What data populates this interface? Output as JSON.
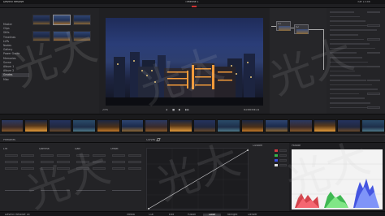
{
  "menubar": {
    "apple": "",
    "app_name": "DaVinci Resolve",
    "menus": [
      "File",
      "Edit",
      "Trim",
      "Timeline",
      "Clip",
      "Mark",
      "View",
      "Playback",
      "Fusion",
      "Color",
      "Fairlight",
      "Workspace",
      "Help"
    ],
    "project_title": "Timeline 1",
    "status_right": "Tue 13:46"
  },
  "media": {
    "clips": [
      {
        "label": "01"
      },
      {
        "label": "02"
      },
      {
        "label": "03"
      },
      {
        "label": "04"
      },
      {
        "label": "05"
      },
      {
        "label": "06"
      }
    ],
    "sidebar_items": [
      "Master",
      "Clips",
      "Stills",
      "Timelines",
      "LUTs",
      "Nodes",
      "Gallery",
      "Power Grade",
      "Memories",
      "Scene",
      "Album 1",
      "Album 2",
      "Grades",
      "Misc"
    ],
    "selected_sidebar_index": 12
  },
  "viewer": {
    "timecode_left": "00:00:00:00",
    "timecode_right": "01:00:04:21",
    "zoom": "25%"
  },
  "nodes": {
    "node1_label": "01",
    "node2_label": "02"
  },
  "timeline_strip": {
    "clip_count": 16
  },
  "color_panel": {
    "section1_title": "Primaries",
    "section2_title": "Curves",
    "section3_title": "Custom",
    "wheel_labels": [
      "Lift",
      "Gamma",
      "Gain",
      "Offset"
    ],
    "curves_label": "Custom",
    "scope_title": "Parade"
  },
  "watermark": {
    "text": "光大"
  },
  "status_bar": {
    "app_label": "DaVinci Resolve 16",
    "pages": [
      "Media",
      "Cut",
      "Edit",
      "Fusion",
      "Color",
      "Fairlight",
      "Deliver"
    ],
    "active_page_index": 4
  },
  "colors": {
    "accent": "#e34b3f",
    "panel": "#232326",
    "bg": "#1b1b1e"
  }
}
